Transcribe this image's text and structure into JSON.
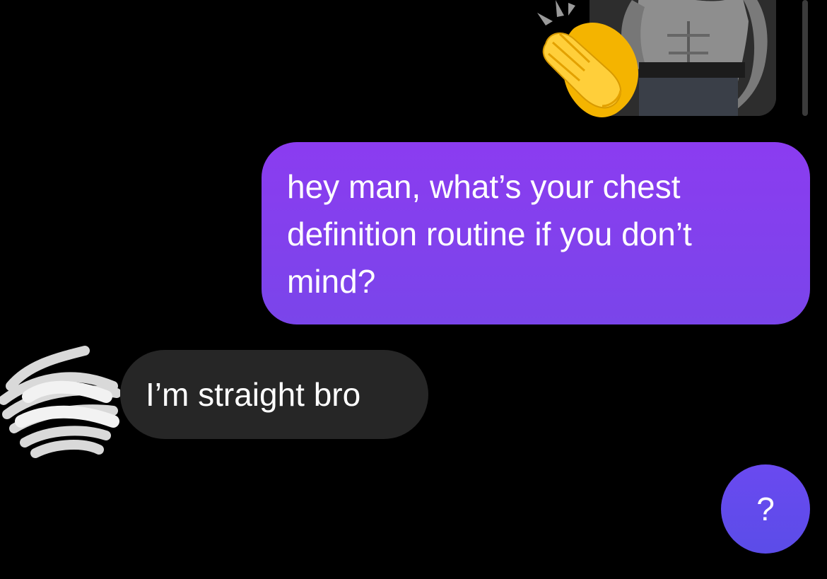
{
  "conversation": {
    "shared_photo": {
      "icon": "shirtless-torso-photo",
      "reaction": "clapping-hands-emoji"
    },
    "messages": [
      {
        "direction": "sent",
        "text": "hey man, what’s your chest definition routine if you don’t mind?"
      },
      {
        "direction": "received",
        "text": "I’m straight bro"
      },
      {
        "direction": "sent",
        "text": "?"
      }
    ]
  },
  "colors": {
    "background": "#000000",
    "sent_bubble": "#8b3cf0",
    "received_bubble": "#262626",
    "last_sent_bubble": "#6a4af0",
    "text": "#ffffff"
  }
}
